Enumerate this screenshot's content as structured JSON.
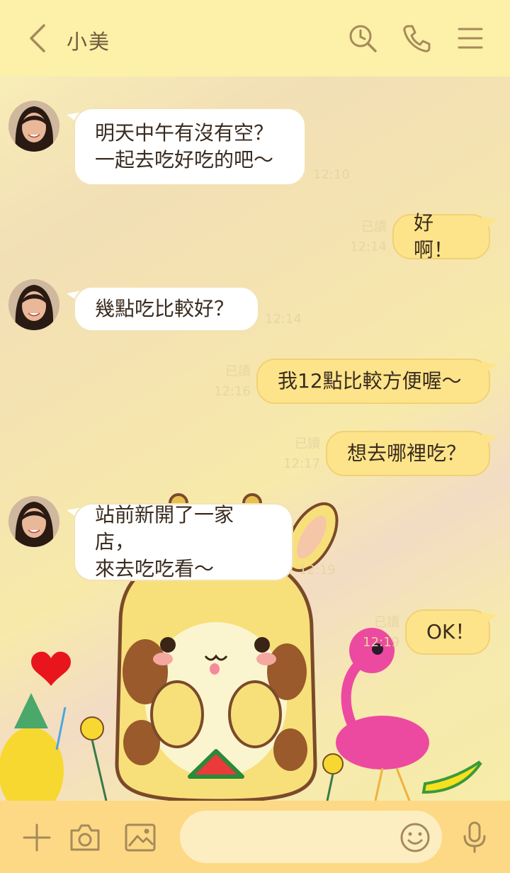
{
  "header": {
    "title": "小美",
    "icons": [
      "back-chevron-icon",
      "search-clock-icon",
      "phone-icon",
      "menu-icon"
    ]
  },
  "messages": [
    {
      "side": "in",
      "text": "明天中午有沒有空？\n一起去吃好吃的吧～",
      "time": "12:10"
    },
    {
      "side": "out",
      "text": "好啊！",
      "read": "已讀",
      "time": "12:14"
    },
    {
      "side": "in",
      "text": "幾點吃比較好？",
      "time": "12:14"
    },
    {
      "side": "out",
      "text": "我12點比較方便喔～",
      "read": "已讀",
      "time": "12:16"
    },
    {
      "side": "out",
      "text": "想去哪裡吃？",
      "read": "已讀",
      "time": "12:17"
    },
    {
      "side": "in",
      "text": "站前新開了一家店，\n來去吃吃看～",
      "time": "12:19"
    },
    {
      "side": "out",
      "text": "OK！",
      "read": "已讀",
      "time": "12:19"
    }
  ],
  "footer": {
    "input_placeholder": "",
    "icons": [
      "plus-icon",
      "camera-icon",
      "image-icon",
      "emoji-icon",
      "microphone-icon"
    ]
  },
  "colors": {
    "header_bg": "#fdf0a8",
    "footer_bg": "#fdd985",
    "bubble_out": "#fde48a",
    "bubble_in": "#ffffff",
    "icon": "#a58a5a"
  }
}
